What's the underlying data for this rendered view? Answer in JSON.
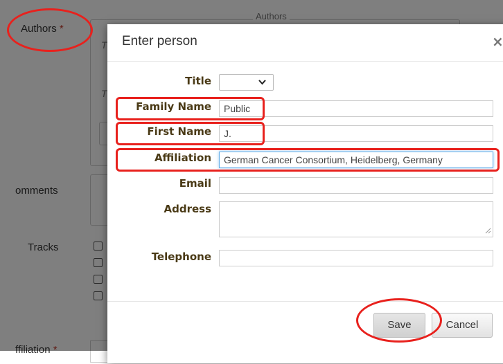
{
  "background_form": {
    "authors_label": "Authors",
    "required_mark": "*",
    "fieldset_legend": "Authors",
    "title_stub_1": "T",
    "title_stub_2": "T",
    "comments_label": "omments",
    "tracks_label": "Tracks",
    "affiliation_label": "ffiliation",
    "affiliation_required": "*"
  },
  "dialog": {
    "title": "Enter person",
    "close_glyph": "×",
    "fields": {
      "title": {
        "label": "Title",
        "value": ""
      },
      "family_name": {
        "label": "Family Name",
        "value": "Public"
      },
      "first_name": {
        "label": "First Name",
        "value": "J."
      },
      "affiliation": {
        "label": "Affiliation",
        "value": "German Cancer Consortium, Heidelberg, Germany"
      },
      "email": {
        "label": "Email",
        "value": ""
      },
      "address": {
        "label": "Address",
        "value": ""
      },
      "telephone": {
        "label": "Telephone",
        "value": ""
      }
    },
    "buttons": {
      "save": "Save",
      "cancel": "Cancel"
    }
  },
  "icons": {
    "dropdown": "chevron-down-icon",
    "close": "close-icon",
    "resize": "resize-handle-icon"
  },
  "colors": {
    "label_text": "#4a3a16",
    "annotation_red": "#e8211d",
    "focus_border": "#66afe9",
    "overlay": "rgba(0,0,0,0.5)"
  }
}
